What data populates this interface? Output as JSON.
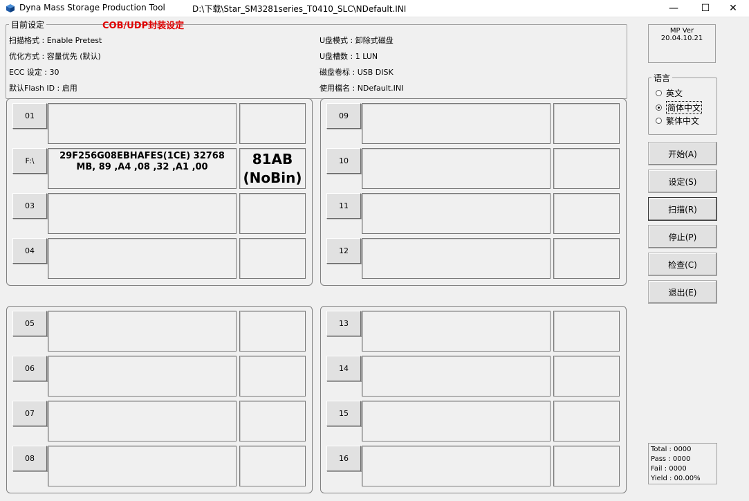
{
  "window": {
    "title": "Dyna Mass Storage Production Tool",
    "path": "D:\\下载\\Star_SM3281series_T0410_SLC\\NDefault.INI",
    "minimize": "—",
    "maximize": "☐",
    "close": "✕"
  },
  "settings": {
    "legend": "目前设定",
    "cob_label": "COB/UDP封装设定",
    "left": [
      "扫描格式 : Enable Pretest",
      "优化方式 : 容量优先 (默认)",
      "ECC 设定 : 30",
      "默认Flash ID : 启用"
    ],
    "right": [
      "U盘模式 : 卸除式磁盘",
      "U盘槽数 : 1 LUN",
      "磁盘卷标 : USB DISK",
      "使用檔名 : NDefault.INI"
    ]
  },
  "version": "MP Ver 20.04.10.21",
  "language": {
    "legend": "语言",
    "options": [
      "英文",
      "简体中文",
      "繁体中文"
    ],
    "selected_index": 1
  },
  "buttons": {
    "start": "开始(A)",
    "settings": "设定(S)",
    "scan": "扫描(R)",
    "stop": "停止(P)",
    "check": "检查(C)",
    "exit": "退出(E)"
  },
  "ports": [
    {
      "label": "01",
      "info": "",
      "bin": ""
    },
    {
      "label": "F:\\",
      "info": "29F256G08EBHAFES(1CE) 32768 MB, 89 ,A4 ,08 ,32 ,A1 ,00",
      "bin": "81AB (NoBin)"
    },
    {
      "label": "03",
      "info": "",
      "bin": ""
    },
    {
      "label": "04",
      "info": "",
      "bin": ""
    },
    {
      "label": "05",
      "info": "",
      "bin": ""
    },
    {
      "label": "06",
      "info": "",
      "bin": ""
    },
    {
      "label": "07",
      "info": "",
      "bin": ""
    },
    {
      "label": "08",
      "info": "",
      "bin": ""
    },
    {
      "label": "09",
      "info": "",
      "bin": ""
    },
    {
      "label": "10",
      "info": "",
      "bin": ""
    },
    {
      "label": "11",
      "info": "",
      "bin": ""
    },
    {
      "label": "12",
      "info": "",
      "bin": ""
    },
    {
      "label": "13",
      "info": "",
      "bin": ""
    },
    {
      "label": "14",
      "info": "",
      "bin": ""
    },
    {
      "label": "15",
      "info": "",
      "bin": ""
    },
    {
      "label": "16",
      "info": "",
      "bin": ""
    }
  ],
  "stats": {
    "total": "Total : 0000",
    "pass": "Pass : 0000",
    "fail": "Fail    : 0000",
    "yield": "Yield : 00.00%"
  }
}
